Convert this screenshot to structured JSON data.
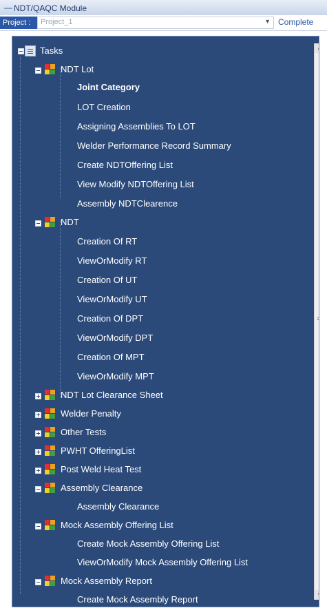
{
  "window": {
    "title": "NDT/QAQC Module"
  },
  "project": {
    "label": "Project :",
    "value": "Project_1",
    "complete_label": "Complete"
  },
  "colors": {
    "tree_bg": "#2b4a7a",
    "accent": "#2b58a6"
  },
  "tree": {
    "root": "Tasks",
    "ndt_lot": {
      "label": "NDT Lot",
      "children": [
        "Joint Category",
        "LOT Creation",
        "Assigning Assemblies To LOT",
        "Welder Performance Record Summary",
        "Create NDTOffering List",
        "View Modify NDTOffering List",
        "Assembly NDTClearence"
      ]
    },
    "ndt": {
      "label": "NDT",
      "children": [
        "Creation Of RT",
        "ViewOrModify RT",
        "Creation Of UT",
        "ViewOrModify UT",
        "Creation Of DPT",
        "ViewOrModify DPT",
        "Creation Of MPT",
        "ViewOrModify MPT"
      ]
    },
    "collapsed_groups": [
      "NDT Lot Clearance Sheet",
      "Welder Penalty",
      "Other Tests",
      "PWHT OfferingList",
      "Post Weld Heat Test"
    ],
    "assembly_clearance": {
      "label": "Assembly Clearance",
      "children": [
        "Assembly Clearance"
      ]
    },
    "mock_offering": {
      "label": "Mock Assembly Offering List",
      "children": [
        "Create Mock Assembly Offering List",
        "ViewOrModify Mock Assembly Offering List"
      ]
    },
    "mock_report": {
      "label": "Mock Assembly Report",
      "children": [
        "Create Mock Assembly Report"
      ]
    }
  }
}
